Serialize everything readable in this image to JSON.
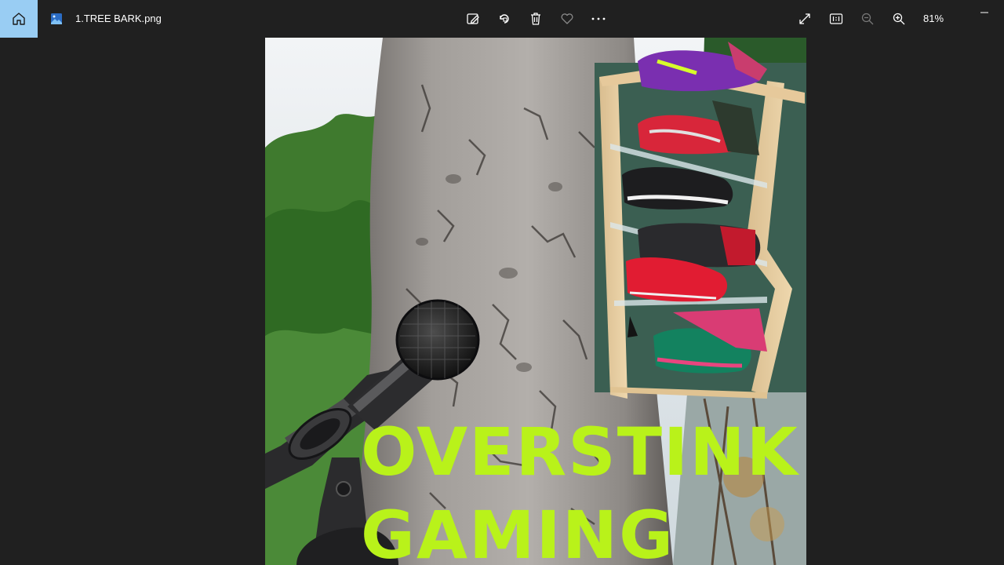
{
  "window": {
    "file_name": "1.TREE BARK.png"
  },
  "icons": {
    "home": "home-icon",
    "file": "image-file-icon",
    "edit": "edit-image-icon",
    "rotate": "rotate-icon",
    "delete": "delete-icon",
    "favorite": "heart-icon",
    "more": "more-icon",
    "fullscreen": "expand-icon",
    "actual_size": "actual-size-icon",
    "zoom_out": "zoom-out-icon",
    "zoom_in": "zoom-in-icon",
    "minimize": "minimize-icon"
  },
  "toolbar": {
    "zoom_level": "81%"
  },
  "image": {
    "line1": "OVERSTINK",
    "line2": "GAMING",
    "text_color": "#b9f21a"
  },
  "colors": {
    "accent": "#99cdf3",
    "background": "#202020"
  }
}
